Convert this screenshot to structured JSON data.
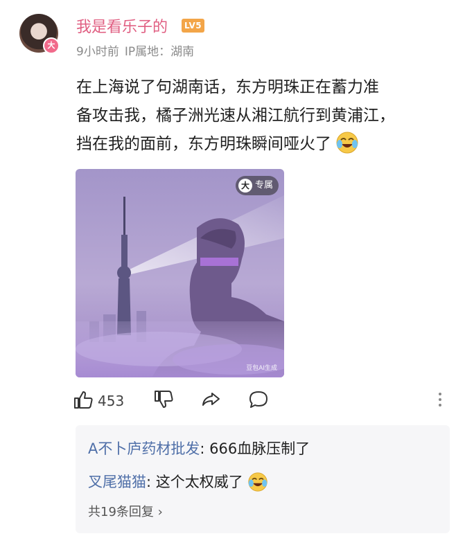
{
  "post": {
    "username": "我是看乐子的",
    "level": "LV5",
    "avatar_badge": "大",
    "time": "9小时前",
    "location": "IP属地：湖南",
    "text_line1": "在上海说了句湖南话，东方明珠正在蓄力准",
    "text_line2": "备攻击我，橘子洲光速从湘江航行到黄浦江，",
    "text_line3": "挡在我的面前，东方明珠瞬间哑火了",
    "text_emoji": "laugh-cry-emoji",
    "image": {
      "badge_icon": "大",
      "badge_text": "专属",
      "watermark": "豆包AI生成"
    }
  },
  "actions": {
    "like_count": "453",
    "icons": [
      "thumbs-up-icon",
      "thumbs-down-icon",
      "share-icon",
      "comment-icon",
      "more-vertical-icon"
    ]
  },
  "replies": [
    {
      "name": "A不卜庐药材批发",
      "text": ": 666血脉压制了"
    },
    {
      "name": "叉尾猫猫",
      "text": ": 这个太权威了"
    }
  ],
  "more_replies": "共19条回复 ›",
  "colors": {
    "username": "#e05f82",
    "reply_name": "#4f6fa8",
    "level_badge": "#f3a548",
    "reply_bg": "#f6f6f8"
  }
}
